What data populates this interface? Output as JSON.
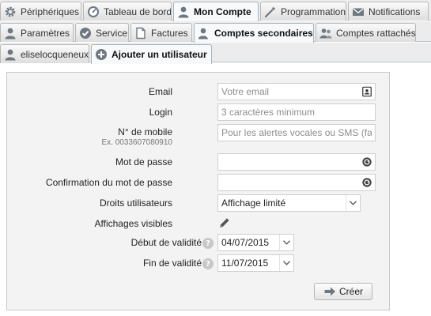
{
  "nav": {
    "main_tabs": [
      {
        "label": "Périphériques",
        "icon": "gear-icon"
      },
      {
        "label": "Tableau de bord",
        "icon": "dashboard-icon"
      },
      {
        "label": "Mon Compte",
        "icon": "user-icon",
        "active": true
      },
      {
        "label": "Programmation",
        "icon": "magic-wand-icon"
      },
      {
        "label": "Notifications",
        "icon": "envelope-icon"
      }
    ],
    "account_tabs": [
      {
        "label": "Paramètres",
        "icon": "user-icon"
      },
      {
        "label": "Service",
        "icon": "check-circle-icon"
      },
      {
        "label": "Factures",
        "icon": "document-icon"
      },
      {
        "label": "Comptes secondaires",
        "icon": "add-user-icon",
        "active": true
      },
      {
        "label": "Comptes rattachés",
        "icon": "linked-users-icon"
      }
    ],
    "sub_tabs": [
      {
        "label": "eliselocqueneux",
        "icon": "user-icon"
      },
      {
        "label": "Ajouter un utilisateur",
        "icon": "plus-circle-icon",
        "active": true
      }
    ]
  },
  "form": {
    "email": {
      "label": "Email",
      "placeholder": "Votre email",
      "value": ""
    },
    "login": {
      "label": "Login",
      "placeholder": "3 caractères minimum",
      "value": ""
    },
    "mobile": {
      "label": "N° de mobile",
      "hint": "Ex. 0033607080910",
      "placeholder": "Pour les alertes vocales ou SMS (fac",
      "value": ""
    },
    "password": {
      "label": "Mot de passe",
      "value": ""
    },
    "password_confirm": {
      "label": "Confirmation du mot de passe",
      "value": ""
    },
    "rights": {
      "label": "Droits utilisateurs",
      "value": "Affichage limité"
    },
    "visible_displays": {
      "label": "Affichages visibles"
    },
    "start_date": {
      "label": "Début de validité",
      "value": "04/07/2015",
      "help": "?"
    },
    "end_date": {
      "label": "Fin de validité",
      "value": "11/07/2015",
      "help": "?"
    },
    "submit_label": "Créer"
  },
  "colors": {
    "tab_bar": "#ececec",
    "panel_bg": "#f3f3f3",
    "icon_gray": "#6f7780"
  }
}
